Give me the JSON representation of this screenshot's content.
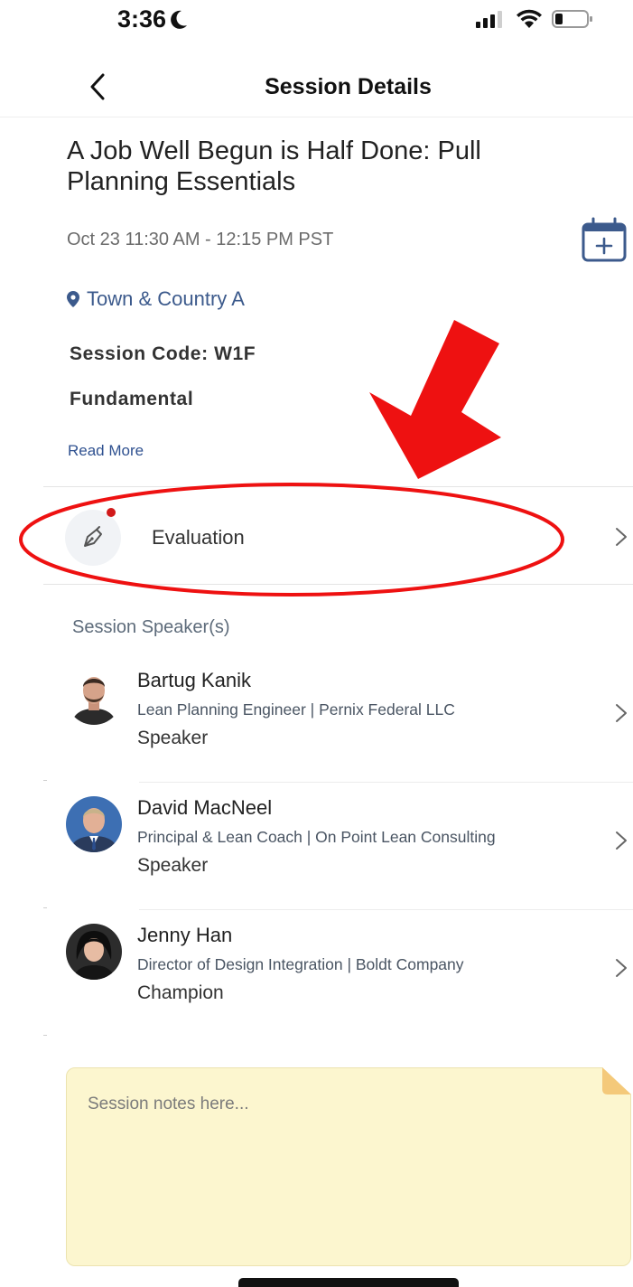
{
  "status_bar": {
    "time": "3:36"
  },
  "nav": {
    "title": "Session Details"
  },
  "session": {
    "title": "A Job Well Begun is Half Done:  Pull Planning Essentials",
    "datetime": "Oct 23  11:30 AM - 12:15 PM  PST",
    "location": "Town & Country A",
    "code": "Session Code: W1F",
    "level": "Fundamental",
    "read_more": "Read More"
  },
  "evaluation": {
    "label": "Evaluation"
  },
  "speakers": {
    "header": "Session Speaker(s)",
    "items": [
      {
        "name": "Bartug Kanik",
        "title": "Lean Planning Engineer | Pernix Federal LLC",
        "role": "Speaker"
      },
      {
        "name": "David MacNeel",
        "title": "Principal & Lean Coach | On Point Lean Consulting",
        "role": "Speaker"
      },
      {
        "name": "Jenny Han",
        "title": "Director of Design Integration | Boldt Company",
        "role": "Champion"
      }
    ]
  },
  "notes": {
    "placeholder": "Session notes here..."
  },
  "colors": {
    "accent": "#3c5a8c",
    "link": "#2f5190",
    "notes_bg": "#fcf6cf",
    "annotation": "#ee1111"
  }
}
